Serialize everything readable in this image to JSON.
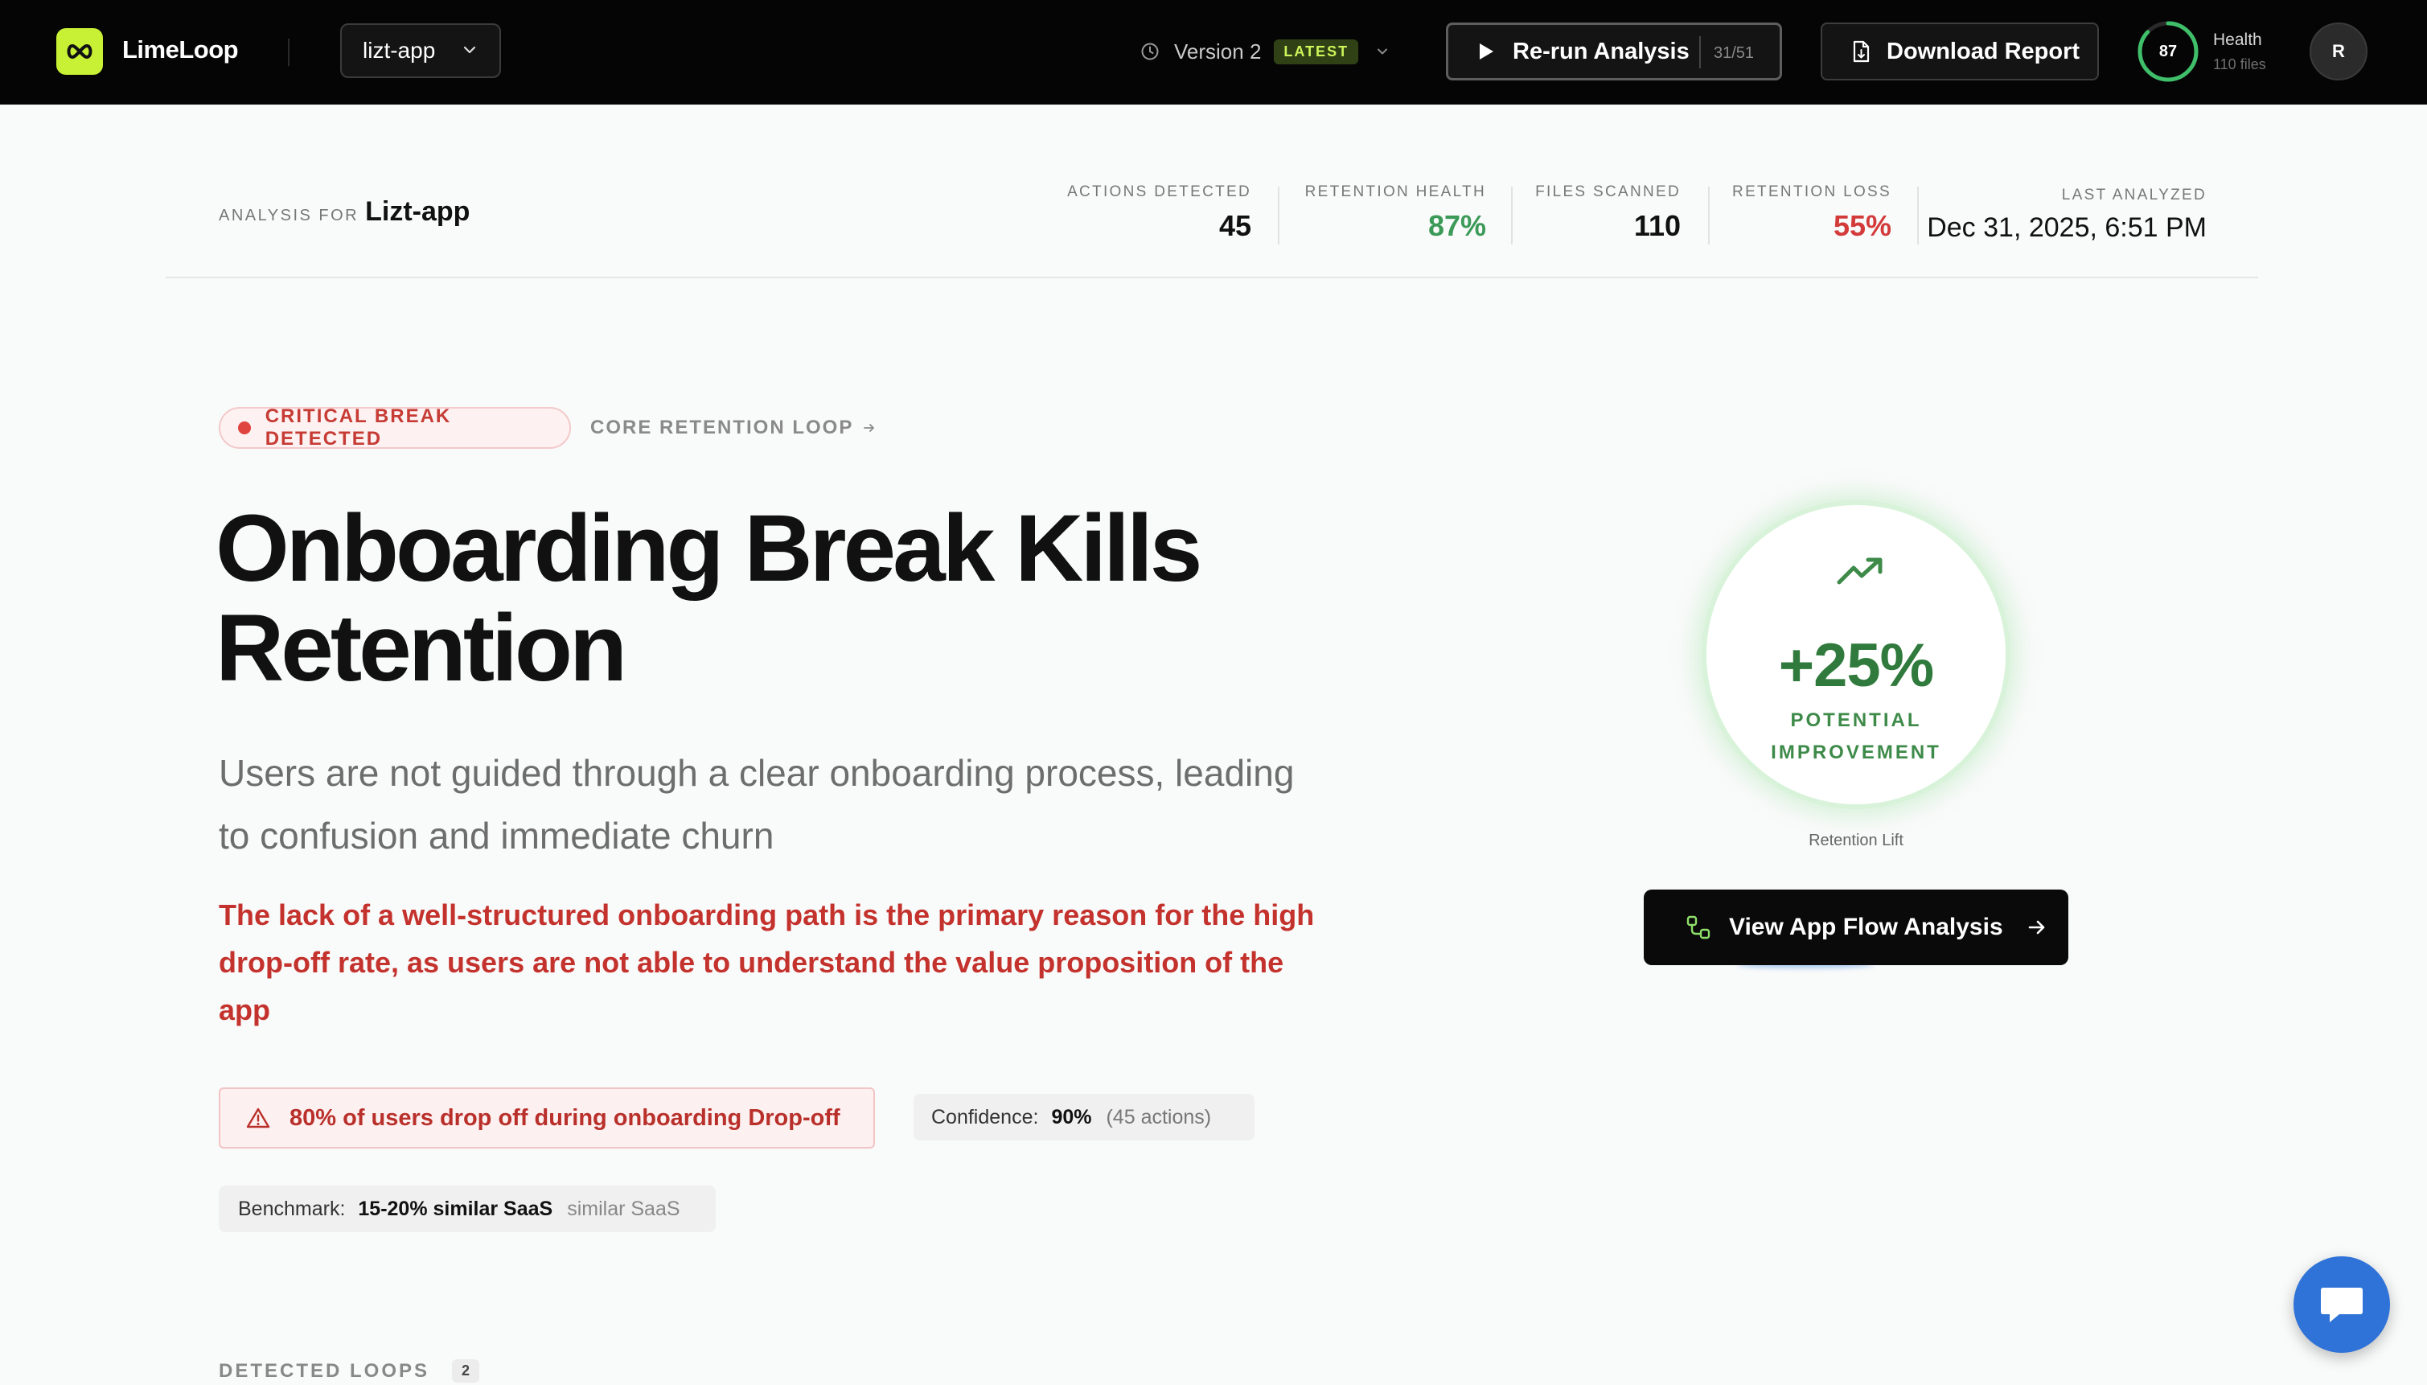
{
  "topbar": {
    "brand": "LimeLoop",
    "project": "lizt-app",
    "version_label": "Version 2",
    "version_badge": "LATEST",
    "rerun_label": "Re-run Analysis",
    "rerun_count": "31/51",
    "download_label": "Download Report",
    "health_value": "87",
    "health_fraction": 0.87,
    "health_label": "Health",
    "health_files": "110 files",
    "avatar_initial": "R"
  },
  "analysis": {
    "for_label": "ANALYSIS FOR",
    "project_name": "Lizt-app",
    "stats": [
      {
        "label": "ACTIONS DETECTED",
        "value": "45"
      },
      {
        "label": "RETENTION HEALTH",
        "value": "87%"
      },
      {
        "label": "FILES SCANNED",
        "value": "110"
      },
      {
        "label": "RETENTION LOSS",
        "value": "55%"
      },
      {
        "label": "LAST ANALYZED",
        "value": "Dec 31, 2025, 6:51 PM"
      }
    ]
  },
  "main": {
    "critical_badge": "CRITICAL BREAK DETECTED",
    "loop_link": "CORE RETENTION LOOP",
    "title_line1": "Onboarding Break Kills",
    "title_line2": "Retention",
    "subtitle": "Users are not guided through a clear onboarding process, leading to confusion and immediate churn",
    "reason": "The lack of a well-structured onboarding path is the primary reason for the high drop-off rate, as users are not able to understand the value proposition of the app",
    "dropoff": "80% of users drop off during onboarding Drop-off",
    "confidence_label": "Confidence:",
    "confidence_value": "90%",
    "confidence_sub": "(45 actions)",
    "benchmark_label": "Benchmark:",
    "benchmark_value": "15-20% similar SaaS",
    "benchmark_sub": "similar SaaS"
  },
  "improvement": {
    "value": "+25%",
    "label_line1": "POTENTIAL",
    "label_line2": "IMPROVEMENT",
    "caption": "Retention Lift",
    "flow_button": "View App Flow Analysis"
  },
  "bottom": {
    "detected_loops_label": "DETECTED LOOPS",
    "detected_loops_count": "2"
  },
  "colors": {
    "accent_lime": "#c8f135",
    "health_green": "#3c9a58",
    "loss_red": "#d33b3b",
    "critical_red": "#c4322d",
    "improve_green": "#2f7a3c",
    "chat_blue": "#2f73d8"
  },
  "icons": {
    "logo": "infinity-icon",
    "project_chevron": "chevron-down-icon",
    "version": "clock-icon",
    "rerun": "play-icon",
    "download": "document-icon",
    "loop_arrow": "arrow-right-icon",
    "dropoff": "warning-triangle-icon",
    "trend": "trending-up-icon",
    "flow": "flow-nodes-icon",
    "chat": "chat-bubble-icon"
  }
}
